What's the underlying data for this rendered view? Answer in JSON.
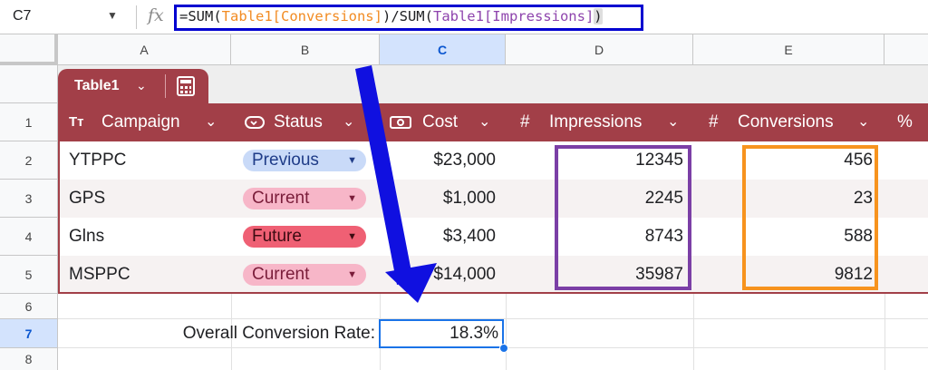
{
  "formula_bar": {
    "name_box": "C7",
    "fx_label": "fx",
    "formula": {
      "prefix": "=SUM(",
      "ref1": "Table1[Conversions]",
      "mid": ")/SUM(",
      "ref2": "Table1[Impressions]",
      "suffix": ")"
    }
  },
  "columns": [
    "A",
    "B",
    "C",
    "D",
    "E"
  ],
  "rows": [
    "1",
    "2",
    "3",
    "4",
    "5",
    "6",
    "7",
    "8"
  ],
  "table": {
    "name": "Table1",
    "headers": {
      "campaign": "Campaign",
      "status": "Status",
      "cost": "Cost",
      "impressions": "Impressions",
      "conversions": "Conversions",
      "extra": "%"
    },
    "rows": [
      {
        "campaign": "YTPPC",
        "status": "Previous",
        "cost": "$23,000",
        "impressions": "12345",
        "conversions": "456"
      },
      {
        "campaign": "GPS",
        "status": "Current",
        "cost": "$1,000",
        "impressions": "2245",
        "conversions": "23"
      },
      {
        "campaign": "Glns",
        "status": "Future",
        "cost": "$3,400",
        "impressions": "8743",
        "conversions": "588"
      },
      {
        "campaign": "MSPPC",
        "status": "Current",
        "cost": "$14,000",
        "impressions": "35987",
        "conversions": "9812"
      }
    ]
  },
  "summary": {
    "label": "Overall Conversion Rate:",
    "value": "18.3%"
  },
  "colors": {
    "table_header": "#a23f48",
    "formula_box": "#0000d0",
    "impressions_highlight": "#7b3fa6",
    "conversions_highlight": "#f7931e",
    "selection": "#1a73e8"
  }
}
